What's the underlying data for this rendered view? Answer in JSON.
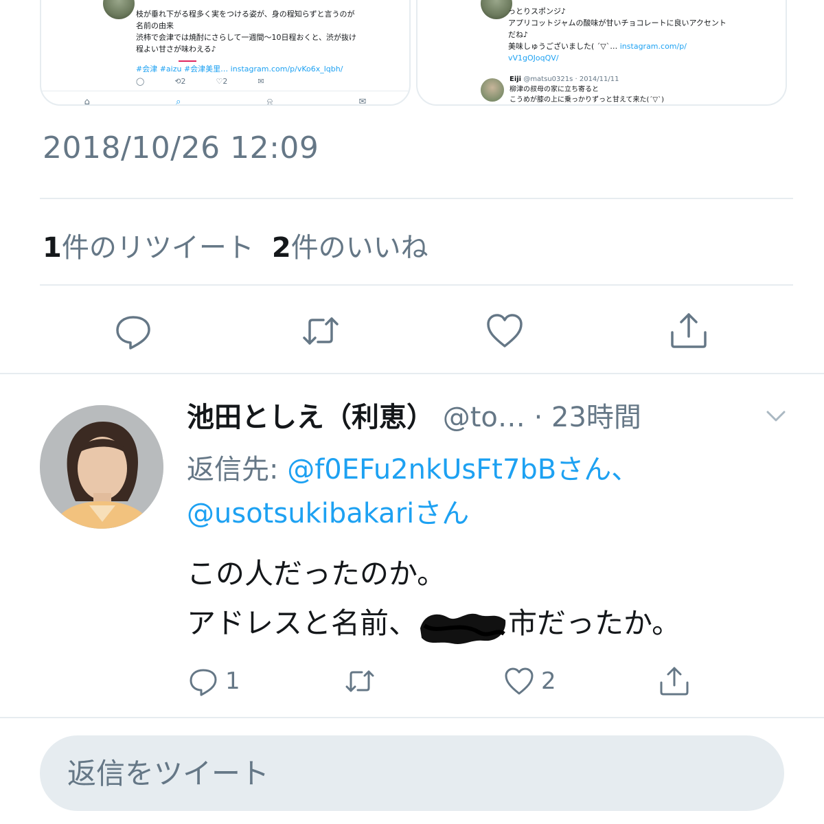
{
  "embedded_left": {
    "lines": [
      "枝が垂れ下がる程多く実をつける姿が、身の程知らずと言うのが",
      "名前の由来",
      "渋柿で会津では焼酎にさらして一週間〜10日程おくと、渋が抜け",
      "程よい甘さが味わえる♪"
    ],
    "tags_link": "#会津 #aizu #会津美里… instagram.com/p/vKo6x_lqbh/",
    "retweet_count": "2",
    "like_count": "2"
  },
  "embedded_right": {
    "lines": [
      "っとりスポンジ♪",
      "アプリコットジャムの酸味が甘いチョコレートに良いアクセント",
      "だね♪"
    ],
    "line4_text": "美味しゅうございました( ´▽`…",
    "line4_link": "instagram.com/p/",
    "line5_link": "vV1gOJoqQV/",
    "sub_name": "Eiji",
    "sub_handle": "@matsu0321s · 2014/11/11",
    "sub_line1": "柳津の叔母の家に立ち寄ると",
    "sub_line2": "こうめが膝の上に乗っかりずっと甘えて来た(´▽`)"
  },
  "tweet": {
    "timestamp": "2018/10/26 12:09",
    "retweet_num": "1",
    "retweet_label": "件のリツイート",
    "like_num": "2",
    "like_label": "件のいいね"
  },
  "reply": {
    "name": "池田としえ（利恵）",
    "meta": " @to… · 23時間",
    "reply_prefix": "返信先: ",
    "mention1": "@f0EFu2nkUsFt7bBさん、",
    "mention2": "@usotsukibakariさん",
    "text_line1": "この人だったのか。",
    "text_line2_a": "アドレスと名前、",
    "text_line2_b": "市だったか。",
    "reply_count": "1",
    "like_count": "2"
  },
  "compose": {
    "placeholder": "返信をツイート"
  },
  "colors": {
    "accent": "#1da1f2",
    "muted": "#657786",
    "divider": "#e6ecf0",
    "highlight": "#e0245e"
  }
}
